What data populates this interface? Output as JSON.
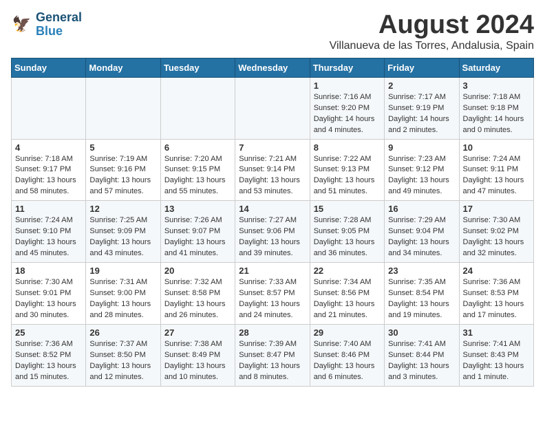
{
  "logo": {
    "line1": "General",
    "line2": "Blue"
  },
  "title": {
    "month_year": "August 2024",
    "location": "Villanueva de las Torres, Andalusia, Spain"
  },
  "weekdays": [
    "Sunday",
    "Monday",
    "Tuesday",
    "Wednesday",
    "Thursday",
    "Friday",
    "Saturday"
  ],
  "weeks": [
    [
      {
        "day": "",
        "content": ""
      },
      {
        "day": "",
        "content": ""
      },
      {
        "day": "",
        "content": ""
      },
      {
        "day": "",
        "content": ""
      },
      {
        "day": "1",
        "content": "Sunrise: 7:16 AM\nSunset: 9:20 PM\nDaylight: 14 hours\nand 4 minutes."
      },
      {
        "day": "2",
        "content": "Sunrise: 7:17 AM\nSunset: 9:19 PM\nDaylight: 14 hours\nand 2 minutes."
      },
      {
        "day": "3",
        "content": "Sunrise: 7:18 AM\nSunset: 9:18 PM\nDaylight: 14 hours\nand 0 minutes."
      }
    ],
    [
      {
        "day": "4",
        "content": "Sunrise: 7:18 AM\nSunset: 9:17 PM\nDaylight: 13 hours\nand 58 minutes."
      },
      {
        "day": "5",
        "content": "Sunrise: 7:19 AM\nSunset: 9:16 PM\nDaylight: 13 hours\nand 57 minutes."
      },
      {
        "day": "6",
        "content": "Sunrise: 7:20 AM\nSunset: 9:15 PM\nDaylight: 13 hours\nand 55 minutes."
      },
      {
        "day": "7",
        "content": "Sunrise: 7:21 AM\nSunset: 9:14 PM\nDaylight: 13 hours\nand 53 minutes."
      },
      {
        "day": "8",
        "content": "Sunrise: 7:22 AM\nSunset: 9:13 PM\nDaylight: 13 hours\nand 51 minutes."
      },
      {
        "day": "9",
        "content": "Sunrise: 7:23 AM\nSunset: 9:12 PM\nDaylight: 13 hours\nand 49 minutes."
      },
      {
        "day": "10",
        "content": "Sunrise: 7:24 AM\nSunset: 9:11 PM\nDaylight: 13 hours\nand 47 minutes."
      }
    ],
    [
      {
        "day": "11",
        "content": "Sunrise: 7:24 AM\nSunset: 9:10 PM\nDaylight: 13 hours\nand 45 minutes."
      },
      {
        "day": "12",
        "content": "Sunrise: 7:25 AM\nSunset: 9:09 PM\nDaylight: 13 hours\nand 43 minutes."
      },
      {
        "day": "13",
        "content": "Sunrise: 7:26 AM\nSunset: 9:07 PM\nDaylight: 13 hours\nand 41 minutes."
      },
      {
        "day": "14",
        "content": "Sunrise: 7:27 AM\nSunset: 9:06 PM\nDaylight: 13 hours\nand 39 minutes."
      },
      {
        "day": "15",
        "content": "Sunrise: 7:28 AM\nSunset: 9:05 PM\nDaylight: 13 hours\nand 36 minutes."
      },
      {
        "day": "16",
        "content": "Sunrise: 7:29 AM\nSunset: 9:04 PM\nDaylight: 13 hours\nand 34 minutes."
      },
      {
        "day": "17",
        "content": "Sunrise: 7:30 AM\nSunset: 9:02 PM\nDaylight: 13 hours\nand 32 minutes."
      }
    ],
    [
      {
        "day": "18",
        "content": "Sunrise: 7:30 AM\nSunset: 9:01 PM\nDaylight: 13 hours\nand 30 minutes."
      },
      {
        "day": "19",
        "content": "Sunrise: 7:31 AM\nSunset: 9:00 PM\nDaylight: 13 hours\nand 28 minutes."
      },
      {
        "day": "20",
        "content": "Sunrise: 7:32 AM\nSunset: 8:58 PM\nDaylight: 13 hours\nand 26 minutes."
      },
      {
        "day": "21",
        "content": "Sunrise: 7:33 AM\nSunset: 8:57 PM\nDaylight: 13 hours\nand 24 minutes."
      },
      {
        "day": "22",
        "content": "Sunrise: 7:34 AM\nSunset: 8:56 PM\nDaylight: 13 hours\nand 21 minutes."
      },
      {
        "day": "23",
        "content": "Sunrise: 7:35 AM\nSunset: 8:54 PM\nDaylight: 13 hours\nand 19 minutes."
      },
      {
        "day": "24",
        "content": "Sunrise: 7:36 AM\nSunset: 8:53 PM\nDaylight: 13 hours\nand 17 minutes."
      }
    ],
    [
      {
        "day": "25",
        "content": "Sunrise: 7:36 AM\nSunset: 8:52 PM\nDaylight: 13 hours\nand 15 minutes."
      },
      {
        "day": "26",
        "content": "Sunrise: 7:37 AM\nSunset: 8:50 PM\nDaylight: 13 hours\nand 12 minutes."
      },
      {
        "day": "27",
        "content": "Sunrise: 7:38 AM\nSunset: 8:49 PM\nDaylight: 13 hours\nand 10 minutes."
      },
      {
        "day": "28",
        "content": "Sunrise: 7:39 AM\nSunset: 8:47 PM\nDaylight: 13 hours\nand 8 minutes."
      },
      {
        "day": "29",
        "content": "Sunrise: 7:40 AM\nSunset: 8:46 PM\nDaylight: 13 hours\nand 6 minutes."
      },
      {
        "day": "30",
        "content": "Sunrise: 7:41 AM\nSunset: 8:44 PM\nDaylight: 13 hours\nand 3 minutes."
      },
      {
        "day": "31",
        "content": "Sunrise: 7:41 AM\nSunset: 8:43 PM\nDaylight: 13 hours\nand 1 minute."
      }
    ]
  ]
}
